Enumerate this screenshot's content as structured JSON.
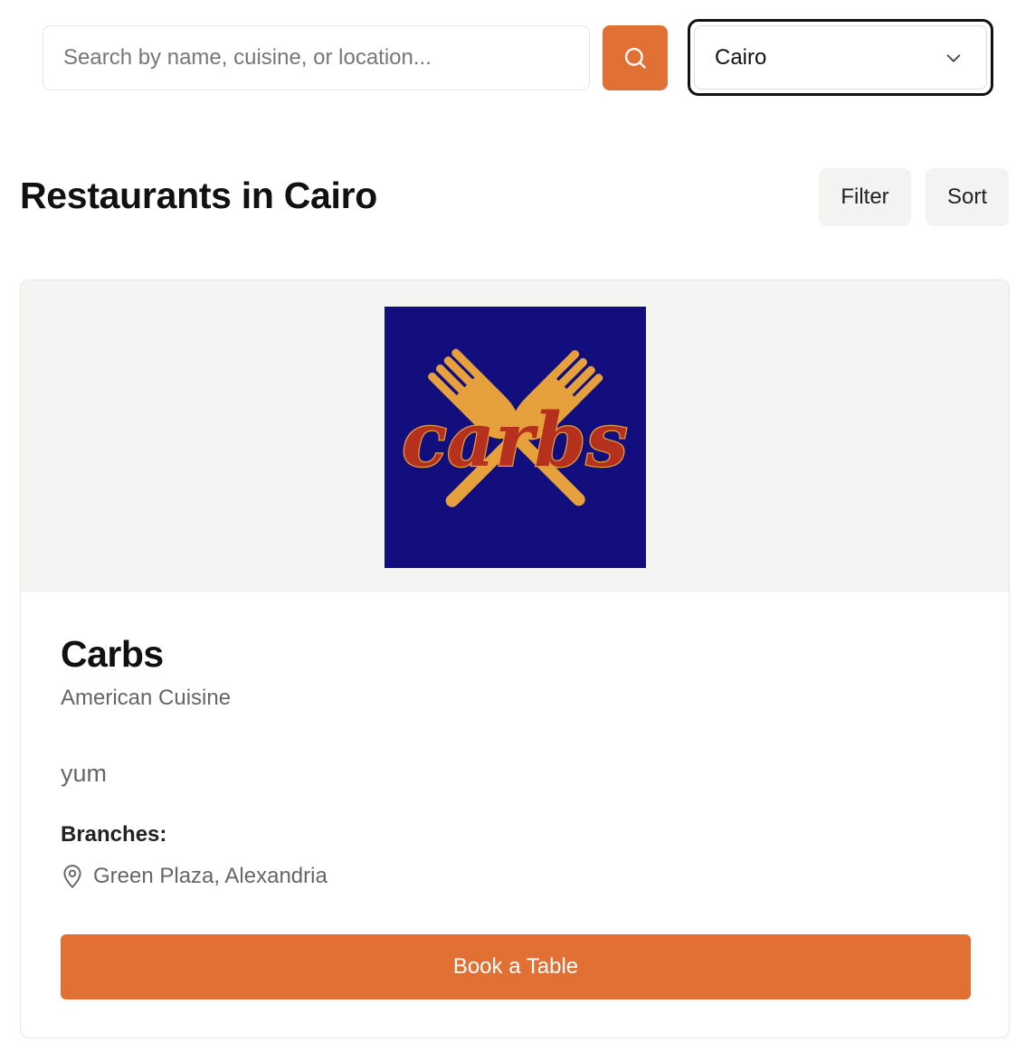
{
  "search": {
    "placeholder": "Search by name, cuisine, or location...",
    "value": ""
  },
  "city_select": {
    "selected": "Cairo"
  },
  "page": {
    "title": "Restaurants in Cairo"
  },
  "toolbar": {
    "filter_label": "Filter",
    "sort_label": "Sort"
  },
  "restaurant": {
    "logo_text": "carbs",
    "name": "Carbs",
    "cuisine": "American Cuisine",
    "description": "yum",
    "branches_heading": "Branches:",
    "branches": [
      "Green Plaza, Alexandria"
    ],
    "book_label": "Book a Table"
  },
  "colors": {
    "accent": "#e07033",
    "logo_bg": "#120e7e",
    "logo_fork": "#e6a03c",
    "logo_script": "#b5311d"
  }
}
